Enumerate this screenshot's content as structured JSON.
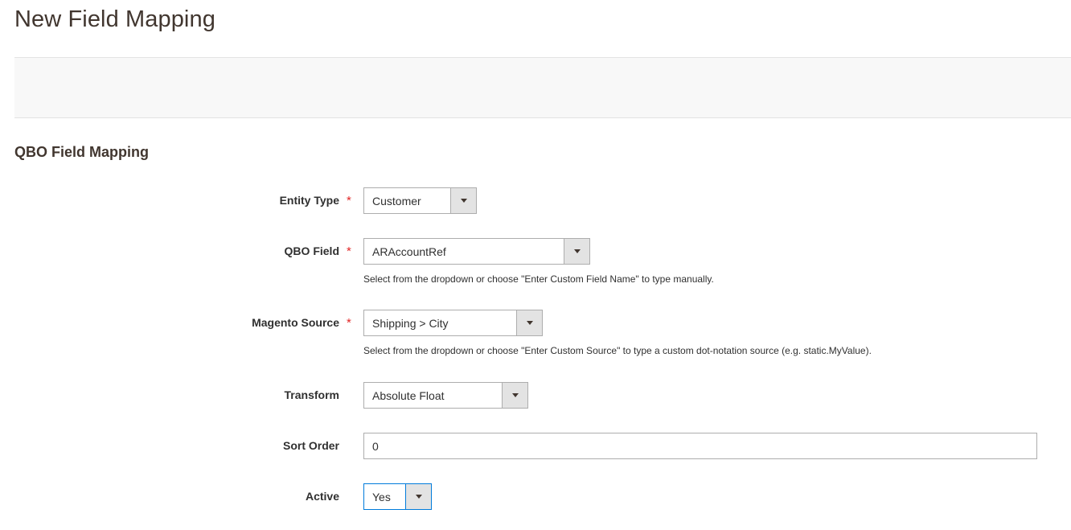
{
  "page": {
    "title": "New Field Mapping"
  },
  "section": {
    "title": "QBO Field Mapping"
  },
  "fields": {
    "entity_type": {
      "label": "Entity Type",
      "required": "*",
      "value": "Customer"
    },
    "qbo_field": {
      "label": "QBO Field",
      "required": "*",
      "value": "ARAccountRef",
      "note": "Select from the dropdown or choose \"Enter Custom Field Name\" to type manually."
    },
    "magento_source": {
      "label": "Magento Source",
      "required": "*",
      "value": "Shipping > City",
      "note": "Select from the dropdown or choose \"Enter Custom Source\" to type a custom dot-notation source (e.g. static.MyValue)."
    },
    "transform": {
      "label": "Transform",
      "value": "Absolute Float"
    },
    "sort_order": {
      "label": "Sort Order",
      "value": "0"
    },
    "active": {
      "label": "Active",
      "value": "Yes"
    }
  },
  "colors": {
    "required": "#e22626",
    "focus_border": "#007bdb",
    "actions_bar_bg": "#f8f8f8"
  },
  "icons": {
    "dropdown": "chevron-down-icon"
  }
}
